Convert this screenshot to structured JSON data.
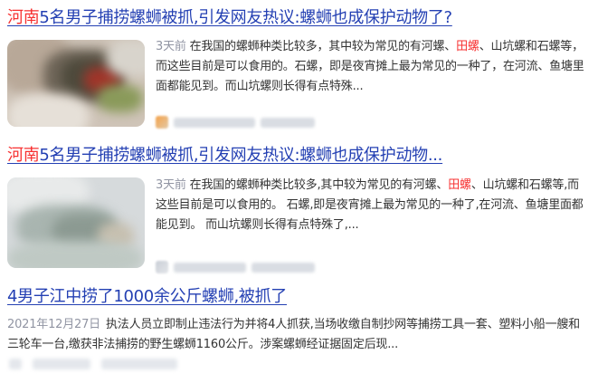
{
  "results": [
    {
      "title_hl": "河南",
      "title_rest": "5名男子捕捞螺蛳被抓,引发网友热议:螺蛳也成保护动物了?",
      "time": "3天前",
      "snippet_a": "在我国的螺蛳种类比较多，其中较为常见的有河螺、",
      "snippet_hl": "田螺",
      "snippet_b": "、山坑螺和石螺等，而这些目前是可以食用的。石螺，即是夜宵摊上最为常见的一种了，在河流、鱼塘里面都能见到。而山坑螺则长得有点特殊..."
    },
    {
      "title_hl": "河南",
      "title_rest": "5名男子捕捞螺蛳被抓,引发网友热议:螺蛳也成保护动物...",
      "time": "3天前",
      "snippet_a": "在我国的螺蛳种类比较多,其中较为常见的有河螺、",
      "snippet_hl": "田螺",
      "snippet_b": "、山坑螺和石螺等,而这些目前是可以食用的。 石螺,即是夜宵摊上最为常见的一种了,在河流、鱼塘里面都能见到。 而山坑螺则长得有点特殊了,..."
    },
    {
      "title": "4男子江中捞了1000余公斤螺蛳,被抓了",
      "time": "2021年12月27日",
      "snippet": "执法人员立即制止违法行为并将4人抓获,当场收缴自制抄网等捕捞工具一套、塑料小船一艘和三轮车一台,缴获非法捕捞的野生螺蛳1160公斤。涉案螺蛳经证据固定后现..."
    }
  ],
  "colors": {
    "title": "#2440b3",
    "highlight": "#f73131",
    "time": "#9195a3",
    "text": "#333333"
  }
}
